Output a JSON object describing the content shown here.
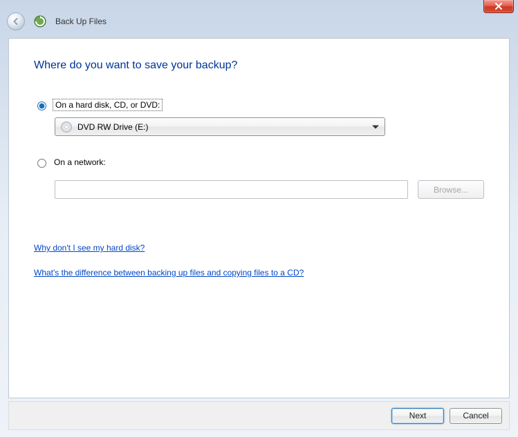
{
  "window": {
    "title": "Back Up Files"
  },
  "main": {
    "heading": "Where do you want to save your backup?",
    "option1": {
      "label": "On a hard disk, CD, or DVD:",
      "selected": true,
      "drive": "DVD RW Drive (E:)"
    },
    "option2": {
      "label": "On a network:",
      "selected": false,
      "path": "",
      "browse_label": "Browse..."
    },
    "links": {
      "link1": "Why don't I see my hard disk?",
      "link2": "What's the difference between backing up files and copying files to a CD?"
    }
  },
  "footer": {
    "next_label": "Next",
    "cancel_label": "Cancel"
  }
}
